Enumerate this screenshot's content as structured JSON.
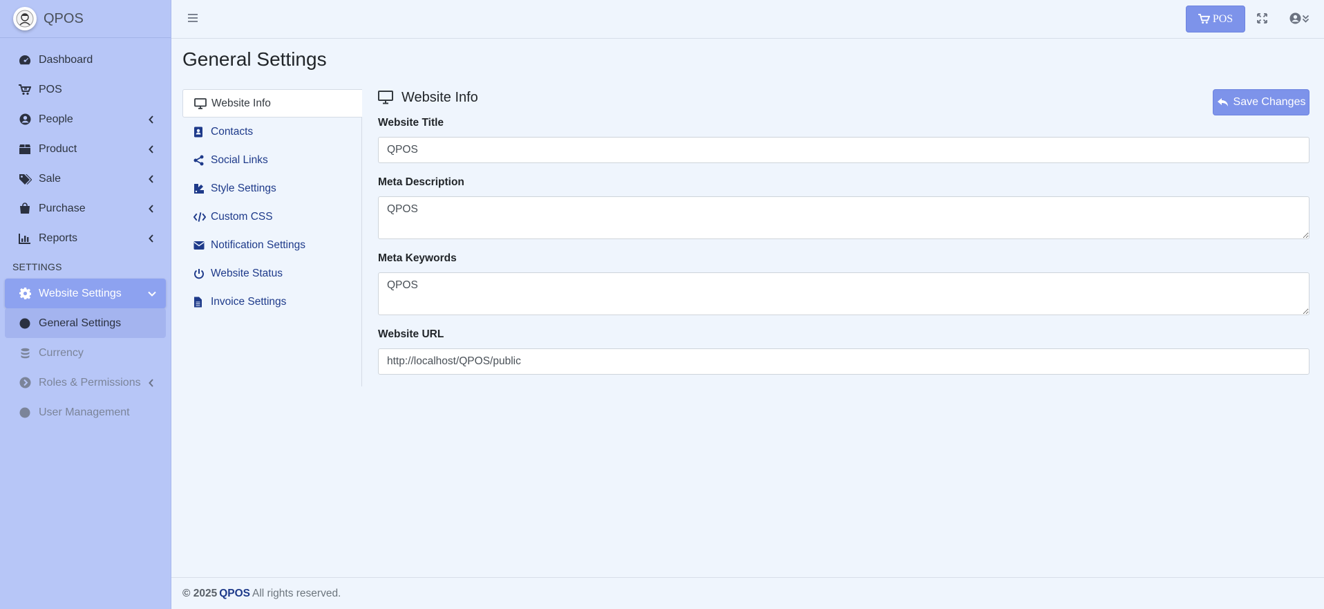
{
  "brand": {
    "name": "QPOS"
  },
  "sidebar": {
    "items": [
      {
        "label": "Dashboard",
        "icon": "dashboard-icon"
      },
      {
        "label": "POS",
        "icon": "cart-icon"
      },
      {
        "label": "People",
        "icon": "user-circle-icon"
      },
      {
        "label": "Product",
        "icon": "box-icon"
      },
      {
        "label": "Sale",
        "icon": "tags-icon"
      },
      {
        "label": "Purchase",
        "icon": "bag-icon"
      },
      {
        "label": "Reports",
        "icon": "chart-icon"
      }
    ],
    "section_header": "SETTINGS",
    "settings_items": [
      {
        "label": "Website Settings",
        "icon": "gear-icon"
      },
      {
        "label": "General Settings",
        "icon": "circle-icon"
      },
      {
        "label": "Currency",
        "icon": "coins-icon"
      },
      {
        "label": "Roles & Permissions",
        "icon": "arrow-circle-icon"
      },
      {
        "label": "User Management",
        "icon": "circle-icon"
      }
    ]
  },
  "topbar": {
    "pos_label": "POS"
  },
  "page": {
    "title": "General Settings"
  },
  "tabs": [
    {
      "label": "Website Info",
      "icon": "monitor-icon"
    },
    {
      "label": "Contacts",
      "icon": "address-book-icon"
    },
    {
      "label": "Social Links",
      "icon": "share-icon"
    },
    {
      "label": "Style Settings",
      "icon": "palette-icon"
    },
    {
      "label": "Custom CSS",
      "icon": "code-icon"
    },
    {
      "label": "Notification Settings",
      "icon": "envelope-icon"
    },
    {
      "label": "Website Status",
      "icon": "power-icon"
    },
    {
      "label": "Invoice Settings",
      "icon": "file-icon"
    }
  ],
  "panel": {
    "title": "Website Info",
    "save_label": "Save Changes",
    "fields": {
      "website_title": {
        "label": "Website Title",
        "value": "QPOS"
      },
      "meta_description": {
        "label": "Meta Description",
        "value": "QPOS"
      },
      "meta_keywords": {
        "label": "Meta Keywords",
        "value": "QPOS"
      },
      "website_url": {
        "label": "Website URL",
        "value": "http://localhost/QPOS/public"
      }
    }
  },
  "footer": {
    "copyright": "© 2025",
    "brand": "QPOS",
    "rights": "All rights reserved."
  },
  "colors": {
    "sidebar_bg": "#b7c6f7",
    "accent": "#7d93ea",
    "link": "#1e3a8a",
    "page_bg": "#eff5fd"
  }
}
